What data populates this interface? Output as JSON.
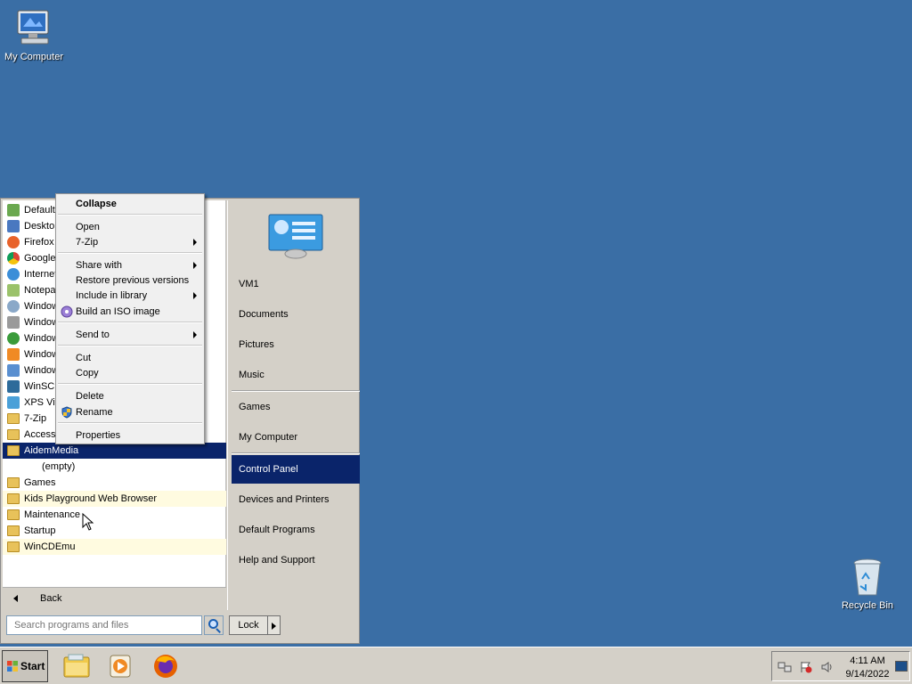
{
  "desktop": {
    "icons": [
      {
        "label": "My Computer"
      },
      {
        "label": "Recycle Bin"
      }
    ]
  },
  "start_menu": {
    "programs": [
      {
        "label": "Default Programs",
        "icon": "default-programs-icon"
      },
      {
        "label": "Desktop Gadget Gallery",
        "icon": "gadgets-icon"
      },
      {
        "label": "Firefox",
        "icon": "firefox-icon"
      },
      {
        "label": "Google Chrome",
        "icon": "chrome-icon"
      },
      {
        "label": "Internet Explorer",
        "icon": "ie-icon"
      },
      {
        "label": "Notepad++",
        "icon": "notepad-icon"
      },
      {
        "label": "Windows DVD Maker",
        "icon": "dvd-maker-icon"
      },
      {
        "label": "Windows Fax and Scan",
        "icon": "fax-icon"
      },
      {
        "label": "Windows Media Center",
        "icon": "media-center-icon"
      },
      {
        "label": "Windows Media Player",
        "icon": "media-player-icon"
      },
      {
        "label": "Windows Update",
        "icon": "windows-update-icon"
      },
      {
        "label": "WinSCP",
        "icon": "winscp-icon"
      },
      {
        "label": "XPS Viewer",
        "icon": "xps-icon"
      },
      {
        "label": "7-Zip",
        "icon": "folder-icon"
      },
      {
        "label": "Accessories",
        "icon": "folder-icon"
      }
    ],
    "expanded_folder": "AidemMedia",
    "empty_label": "(empty)",
    "folders_after": [
      {
        "label": "Games",
        "highlight": false
      },
      {
        "label": "Kids Playground Web Browser",
        "highlight": true
      },
      {
        "label": "Maintenance",
        "highlight": false
      },
      {
        "label": "Startup",
        "highlight": false
      },
      {
        "label": "WinCDEmu",
        "highlight": true
      }
    ],
    "back_label": "Back",
    "search_placeholder": "Search programs and files",
    "right_items": [
      {
        "label": "VM1"
      },
      {
        "label": "Documents"
      },
      {
        "label": "Pictures"
      },
      {
        "label": "Music"
      },
      {
        "label": "Games"
      },
      {
        "label": "My Computer"
      },
      {
        "label": "Control Panel"
      },
      {
        "label": "Devices and Printers"
      },
      {
        "label": "Default Programs"
      },
      {
        "label": "Help and Support"
      }
    ],
    "lock_label": "Lock"
  },
  "context_menu": {
    "items": [
      {
        "label": "Collapse"
      },
      {
        "label": "Open"
      },
      {
        "label": "7-Zip"
      },
      {
        "label": "Share with"
      },
      {
        "label": "Restore previous versions"
      },
      {
        "label": "Include in library"
      },
      {
        "label": "Build an ISO image"
      },
      {
        "label": "Send to"
      },
      {
        "label": "Cut"
      },
      {
        "label": "Copy"
      },
      {
        "label": "Delete"
      },
      {
        "label": "Rename"
      },
      {
        "label": "Properties"
      }
    ]
  },
  "taskbar": {
    "start_label": "Start",
    "time": "4:11 AM",
    "date": "9/14/2022"
  },
  "colors": {
    "desktop": "#3a6ea5",
    "selection": "#0a246a",
    "panel": "#d4d0c8"
  }
}
